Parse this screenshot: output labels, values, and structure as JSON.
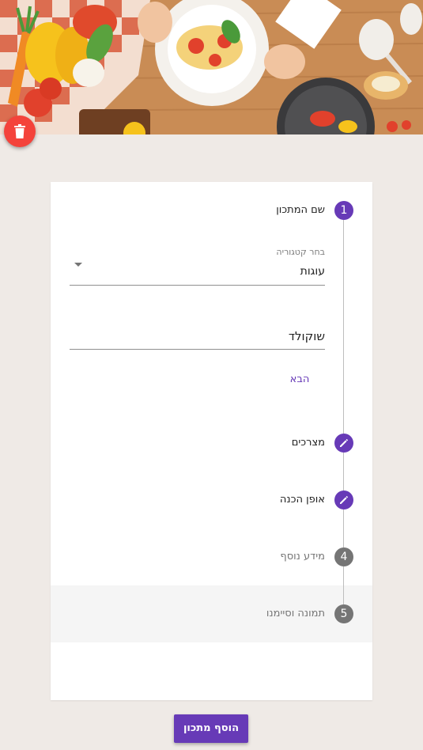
{
  "stepper": {
    "steps": [
      {
        "number": "1",
        "label": "שם המתכון",
        "state": "active"
      },
      {
        "number": "",
        "label": "מצרכים",
        "state": "edited",
        "icon": "pencil-icon"
      },
      {
        "number": "",
        "label": "אופן הכנה",
        "state": "edited",
        "icon": "pencil-icon"
      },
      {
        "number": "4",
        "label": "מידע נוסף",
        "state": "inactive"
      },
      {
        "number": "5",
        "label": "תמונה וסיימנו",
        "state": "inactive"
      }
    ]
  },
  "form": {
    "category": {
      "label": "בחר קטגוריה",
      "value": "עוגות"
    },
    "recipe_name": {
      "value": "שוקולד"
    },
    "next_label": "הבא"
  },
  "actions": {
    "add_recipe_label": "הוסף מתכון",
    "delete_icon": "trash-icon"
  },
  "colors": {
    "primary": "#673ab7",
    "delete": "#f4433b",
    "inactive_step": "#757575",
    "background": "#efeae6"
  }
}
